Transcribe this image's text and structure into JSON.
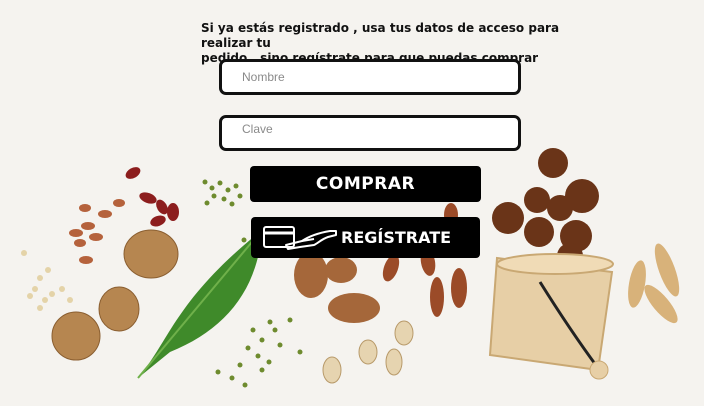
{
  "intro": {
    "line1": "Si ya estás registrado , usa tus datos de acceso para realizar tu",
    "line2": "pedido , sino regístrate para que puedas comprar"
  },
  "form": {
    "name_placeholder": "Nombre",
    "password_placeholder": "Clave"
  },
  "buttons": {
    "buy_label": "COMPRAR",
    "register_label": "REGÍSTRATE",
    "register_icon": "hand-card-icon"
  },
  "colors": {
    "button_bg": "#000000",
    "button_text": "#ffffff",
    "field_border": "#111111",
    "background": "#f5f3ef"
  }
}
